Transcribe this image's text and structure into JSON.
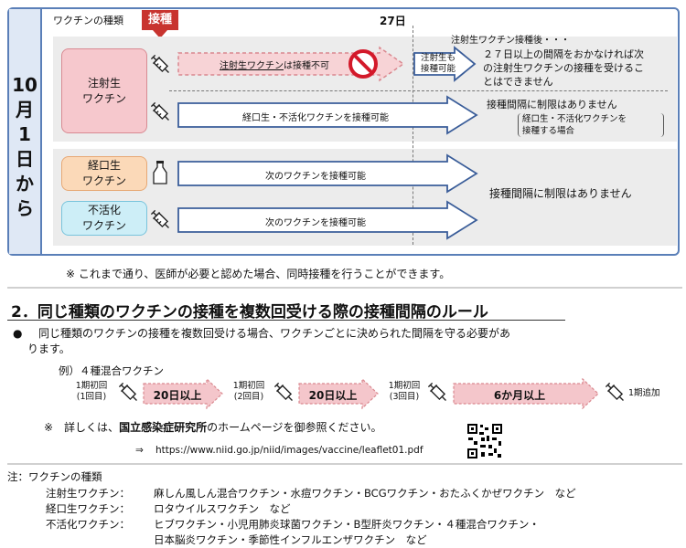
{
  "side_label": [
    "10",
    "月",
    "1",
    "日",
    "から"
  ],
  "header": {
    "vaccine_type_label": "ワクチンの種類",
    "vaccination_badge": "接種",
    "day_label": "27日"
  },
  "rows": {
    "injection_live": {
      "label": [
        "注射生",
        "ワクチン"
      ],
      "arrow1_text_a": "注射生ワクチン",
      "arrow1_text_b": "は接種不可",
      "arrow1_after": [
        "注射生も",
        "接種可能"
      ],
      "note_title": "注射生ワクチン接種後・・・",
      "note_lines": [
        "２７日以上の間隔をおかなければ次",
        "の注射生ワクチンの接種を受けるこ",
        "とはできません"
      ],
      "arrow2_text": "経口生・不活化ワクチンを接種可能",
      "note2_line1": "接種間隔に制限はありません",
      "note2_line2": "経口生・不活化ワクチンを",
      "note2_line3": "接種する場合"
    },
    "oral_live": {
      "label": [
        "経口生",
        "ワクチン"
      ],
      "arrow_text": "次のワクチンを接種可能"
    },
    "inactivated": {
      "label": [
        "不活化",
        "ワクチン"
      ],
      "arrow_text": "次のワクチンを接種可能"
    },
    "shared_note": "接種間隔に制限はありません"
  },
  "footnote1": "※ これまで通り、医師が必要と認めた場合、同時接種を行うことができます。",
  "section2": {
    "title": "2．同じ種類のワクチンの接種を複数回受ける際の接種間隔のルール",
    "bullet": "●",
    "body_line1": "　同じ種類のワクチンの接種を複数回受ける場合、ワクチンごとに決められた間隔を守る必要があ",
    "body_line2": "ります。",
    "example_label": "例）４種混合ワクチン",
    "steps": [
      {
        "line1": "1期初回",
        "line2": "(1回目)"
      },
      {
        "line1": "1期初回",
        "line2": "(2回目)"
      },
      {
        "line1": "1期初回",
        "line2": "(3回目)"
      }
    ],
    "intervals": [
      "20日以上",
      "20日以上",
      "6か月以上"
    ],
    "final_step": "1期追加",
    "details_prefix": "※　詳しくは、",
    "details_org": "国立感染症研究所",
    "details_suffix": "のホームページを御参照ください。",
    "url_arrow": "⇒",
    "url": "https://www.niid.go.jp/niid/images/vaccine/leaflet01.pdf"
  },
  "types_note": {
    "title": "注：ワクチンの種類",
    "injection_label": "注射生ワクチン：",
    "injection_list": "麻しん風しん混合ワクチン・水痘ワクチン・BCGワクチン・おたふくかぜワクチン　など",
    "oral_label": "経口生ワクチン：",
    "oral_list": "ロタウイルスワクチン　など",
    "inactivated_label": "不活化ワクチン：",
    "inactivated_list1": "ヒブワクチン・小児用肺炎球菌ワクチン・B型肝炎ワクチン・４種混合ワクチン・",
    "inactivated_list2": "日本脳炎ワクチン・季節性インフルエンザワクチン　など"
  },
  "colors": {
    "frame": "#5a7fb8",
    "badge": "#c8342f",
    "injection": "#f6c8cd",
    "oral": "#fbd9b8",
    "inactivated": "#cdeef7",
    "interval_arrow": "#f4c6cb"
  }
}
